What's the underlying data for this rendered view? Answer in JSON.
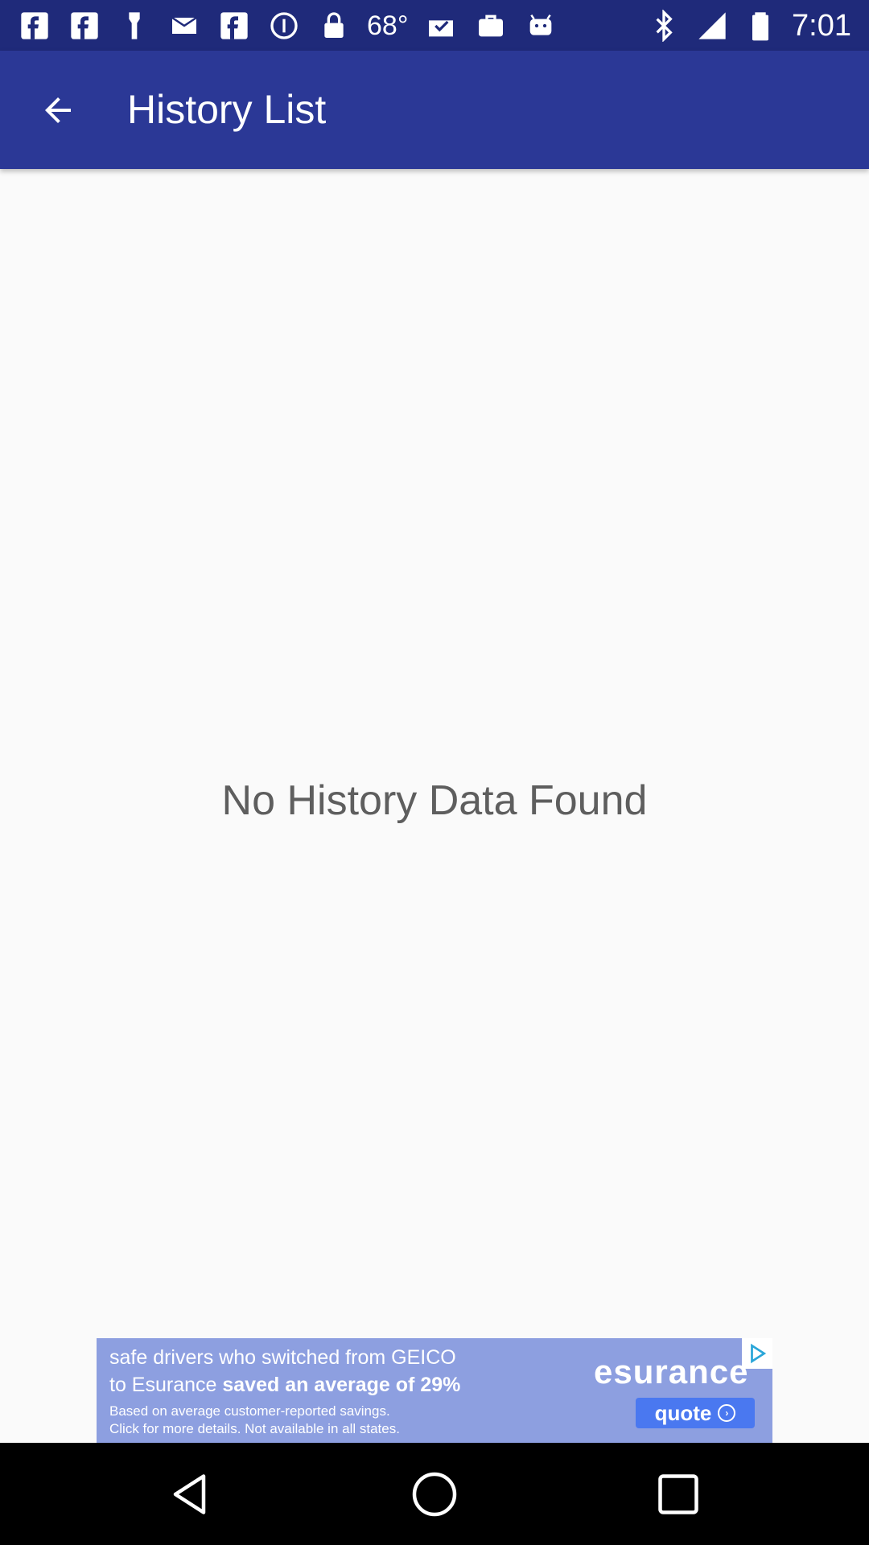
{
  "status_bar": {
    "temperature": "68°",
    "time": "7:01",
    "left_icons": [
      "facebook-icon",
      "facebook-icon",
      "torch-icon",
      "mail-icon",
      "facebook-icon",
      "info-icon",
      "lock-icon"
    ],
    "right_icons": [
      "mail-check-icon",
      "briefcase-icon",
      "android-icon",
      "bluetooth-icon",
      "signal-icon",
      "battery-icon"
    ]
  },
  "app_bar": {
    "title": "History List",
    "back_icon": "arrow-back-icon"
  },
  "main": {
    "empty_message": "No History Data Found"
  },
  "ad": {
    "line1": "safe drivers who switched from GEICO",
    "line2_prefix": "to Esurance ",
    "line2_bold": "saved an average of 29%",
    "line3": "Based on average customer-reported savings.",
    "line4": "Click for more details. Not available in all states.",
    "brand": "esurance",
    "cta": "quote"
  },
  "colors": {
    "status_bar": "#1f2a7a",
    "app_bar": "#2b3896",
    "background": "#fafafa",
    "empty_text": "#5e5e5e"
  }
}
